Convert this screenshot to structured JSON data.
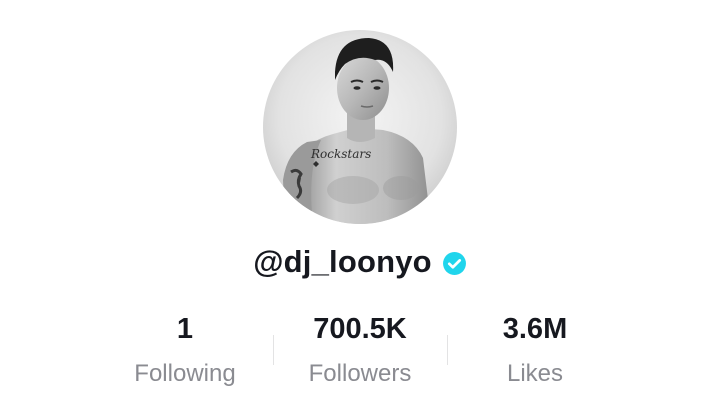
{
  "profile": {
    "avatar_icon": "profile-photo",
    "avatar_tattoo_text": "Rockstars",
    "username": "@dj_loonyo",
    "verified": true,
    "verified_color": "#20D5EC"
  },
  "stats": {
    "following": {
      "value": "1",
      "label": "Following"
    },
    "followers": {
      "value": "700.5K",
      "label": "Followers"
    },
    "likes": {
      "value": "3.6M",
      "label": "Likes"
    }
  },
  "colors": {
    "text_primary": "#16181f",
    "text_secondary": "#8a8b91",
    "divider": "#e3e3e4"
  }
}
